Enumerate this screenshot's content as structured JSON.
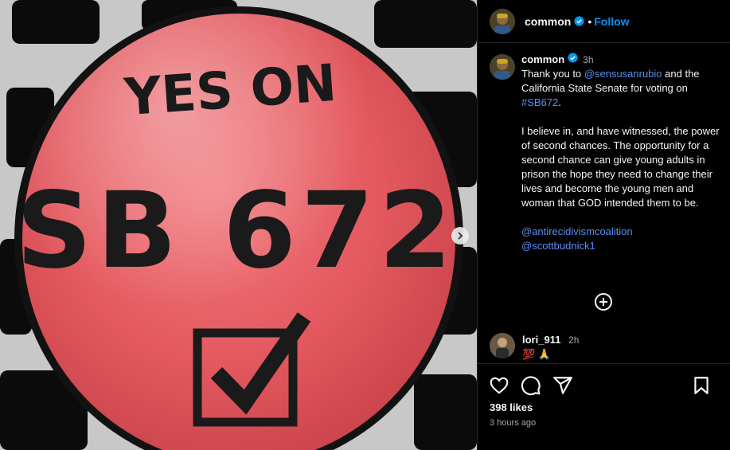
{
  "post": {
    "button_text": {
      "top": "YES ON",
      "main": "SB 672"
    }
  },
  "header": {
    "username": "common",
    "separator": "•",
    "follow_label": "Follow"
  },
  "caption": {
    "username": "common",
    "time": "3h",
    "line1_pre": "Thank you to ",
    "line1_mention": "@sensusanrubio",
    "line1_post": " and the California State Senate for voting on ",
    "hashtag": "#SB672",
    "line1_end": ".",
    "paragraph2": "I believe in, and have witnessed, the power of second chances. The opportunity for a second chance can give young adults in prison the hope they need to change their lives and become the young men and woman that GOD intended them to be.",
    "mention_a": "@antirecidivismcoalition",
    "mention_b": "@scottbudnick1"
  },
  "comment": {
    "username": "lori_911",
    "time": "2h",
    "text": "💯 🙏"
  },
  "footer": {
    "likes": "398 likes",
    "timestamp": "3 hours ago"
  },
  "icons": {
    "verified": "verified-badge-icon",
    "more_comments": "plus-circle-icon",
    "like": "heart-icon",
    "comment": "comment-bubble-icon",
    "share": "paper-plane-icon",
    "save": "bookmark-icon",
    "next": "chevron-right-icon"
  },
  "colors": {
    "accent_blue": "#0095f6",
    "mention_blue": "#5b8def",
    "button_red": "#e8585e"
  }
}
